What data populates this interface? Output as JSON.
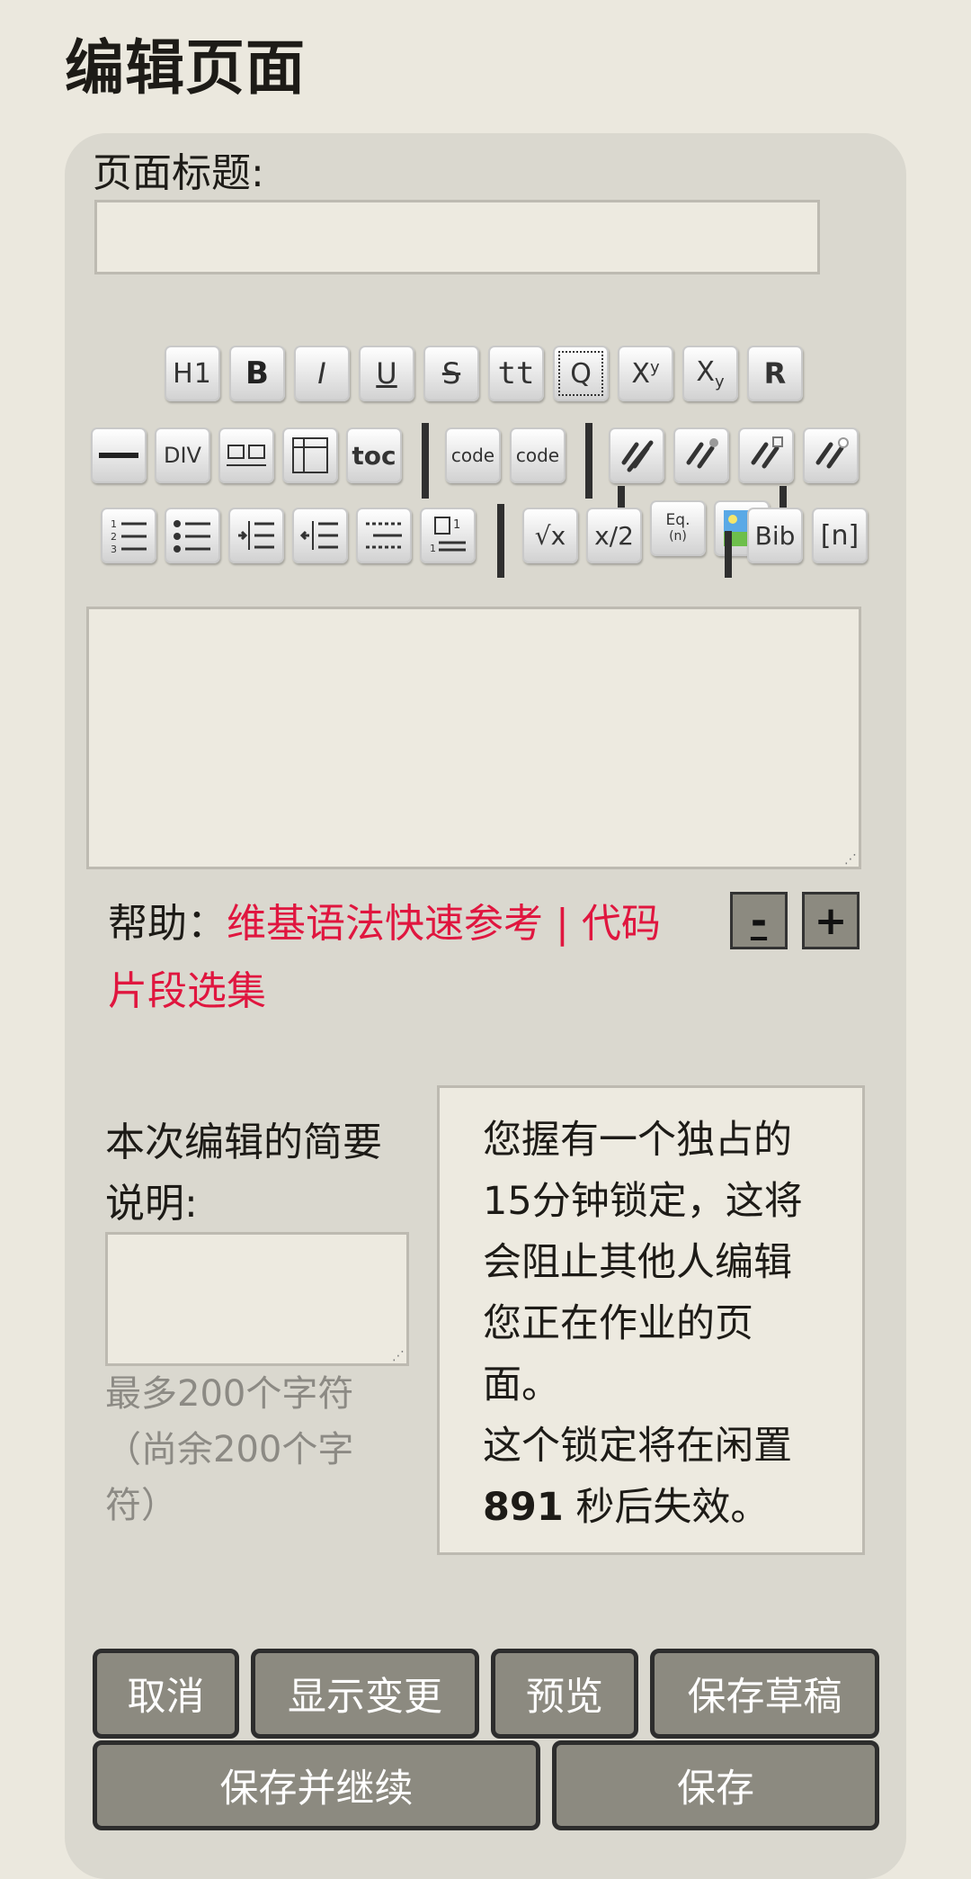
{
  "page": {
    "title": "编辑页面"
  },
  "form": {
    "title_label": "页面标题:",
    "title_value": "",
    "content_value": ""
  },
  "toolbar": {
    "row1": [
      {
        "name": "heading-h1",
        "label": "H1"
      },
      {
        "name": "bold",
        "label": "B"
      },
      {
        "name": "italic",
        "label": "I"
      },
      {
        "name": "underline",
        "label": "U"
      },
      {
        "name": "strikethrough",
        "label": "S"
      },
      {
        "name": "teletype",
        "label": "tt"
      },
      {
        "name": "quote",
        "label": "Q"
      },
      {
        "name": "superscript",
        "label": "X"
      },
      {
        "name": "subscript",
        "label": "X"
      },
      {
        "name": "raw",
        "label": "R"
      }
    ],
    "row2": [
      {
        "name": "horizontal-rule",
        "label": ""
      },
      {
        "name": "div",
        "label": "DIV"
      },
      {
        "name": "columns",
        "label": ""
      },
      {
        "name": "table",
        "label": ""
      },
      {
        "name": "toc",
        "label": "toc"
      },
      {
        "name": "code",
        "label": "code"
      },
      {
        "name": "code-block",
        "label": "code"
      },
      {
        "name": "link",
        "label": ""
      },
      {
        "name": "link-anchor",
        "label": ""
      },
      {
        "name": "link-external",
        "label": ""
      },
      {
        "name": "link-page",
        "label": ""
      }
    ],
    "row3": [
      {
        "name": "numbered-list",
        "label": ""
      },
      {
        "name": "bullet-list",
        "label": ""
      },
      {
        "name": "indent",
        "label": ""
      },
      {
        "name": "outdent",
        "label": ""
      },
      {
        "name": "definition-list",
        "label": ""
      },
      {
        "name": "footnote",
        "label": ""
      },
      {
        "name": "math",
        "label": "√x"
      },
      {
        "name": "inline-math",
        "label": "x/2"
      },
      {
        "name": "equation-ref",
        "label": "Eq."
      },
      {
        "name": "image",
        "label": ""
      },
      {
        "name": "bibliography",
        "label": "Bib"
      },
      {
        "name": "citation",
        "label": "[n]"
      }
    ],
    "superscript_mark": "y",
    "subscript_mark": "y",
    "equation_number": "(n)"
  },
  "help": {
    "label": "帮助：",
    "link_quickref": "维基语法快速参考",
    "divider": "|",
    "link_snippets_part1": "代码",
    "link_snippets_part2": "片段选集",
    "shrink_label": "-",
    "grow_label": "+"
  },
  "summary": {
    "label_line1": "本次编辑的简要",
    "label_line2": "说明:",
    "value": "",
    "counter_line1": "最多200个字符",
    "counter_line2": "（尚余200个字",
    "counter_line3": "符）"
  },
  "lock_notice": {
    "line1": "您握有一个独占的",
    "line2": "15分钟锁定，这将",
    "line3": "会阻止其他人编辑",
    "line4": "您正在作业的页",
    "line5": "面。",
    "line6": "这个锁定将在闲置",
    "seconds": "891",
    "line7_suffix": " 秒后失效。"
  },
  "actions": {
    "cancel": "取消",
    "show_changes": "显示变更",
    "preview": "预览",
    "save_draft": "保存草稿",
    "save_continue": "保存并继续",
    "save": "保存"
  }
}
